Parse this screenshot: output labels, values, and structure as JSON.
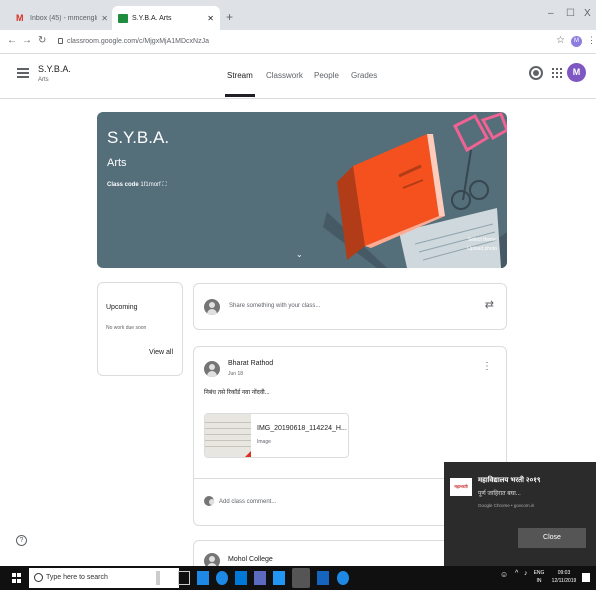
{
  "browser": {
    "tabs": [
      {
        "title": "Inbox (45) - mmcenglishdepartm",
        "active": false
      },
      {
        "title": "S.Y.B.A. Arts",
        "active": true
      }
    ],
    "url": "classroom.google.com/c/MjgxMjA1MDcxNzJa",
    "profile_initial": "M",
    "window_controls": {
      "minimize": "–",
      "maximize": "☐",
      "close": "X"
    }
  },
  "header": {
    "class_name": "S.Y.B.A.",
    "section": "Arts",
    "tabs": [
      "Stream",
      "Classwork",
      "People",
      "Grades"
    ],
    "active_tab": "Stream",
    "avatar_initial": "M"
  },
  "banner": {
    "title": "S.Y.B.A.",
    "subtitle": "Arts",
    "class_code_label": "Class code",
    "class_code": "1f1morf",
    "select_theme": "Select theme",
    "upload_photo": "Upload photo",
    "color": "#546e7a"
  },
  "upcoming": {
    "title": "Upcoming",
    "status": "No work due soon",
    "view_all": "View all"
  },
  "share": {
    "placeholder": "Share something with your class..."
  },
  "posts": [
    {
      "author": "Bharat Rathod",
      "date": "Jun 18",
      "text": "निबंध तसे रिकॉर्ड नवा नोंदवी...",
      "attachment": {
        "name": "IMG_20190618_114224_H...",
        "type": "Image"
      },
      "comment_placeholder": "Add class comment..."
    },
    {
      "author": "Mohol College"
    }
  ],
  "notification": {
    "title": "महाविद्यालय भरती २०१९",
    "body": "पूर्ण जाहिरात बघा...",
    "source": "Google Chrome • govcom.in",
    "close": "Close",
    "logo_text": "महाभरती"
  },
  "taskbar": {
    "search_placeholder": "Type here to search",
    "language": "ENG",
    "region": "IN",
    "time": "09:03",
    "date": "12/11/2019"
  }
}
